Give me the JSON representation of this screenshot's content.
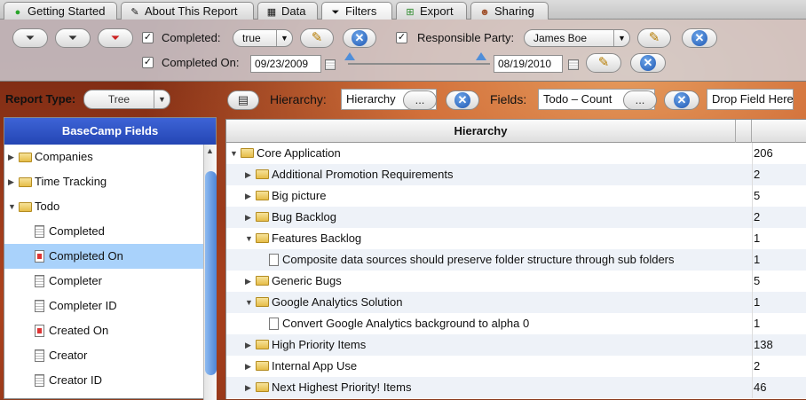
{
  "tabs": [
    {
      "label": "Getting Started",
      "icon": "green-dot-icon"
    },
    {
      "label": "About This Report",
      "icon": "pencil-note-icon"
    },
    {
      "label": "Data",
      "icon": "table-icon"
    },
    {
      "label": "Filters",
      "icon": "funnel-icon",
      "active": true
    },
    {
      "label": "Export",
      "icon": "export-icon"
    },
    {
      "label": "Sharing",
      "icon": "people-icon"
    }
  ],
  "filters": {
    "completed": {
      "label": "Completed:",
      "value": "true",
      "checked": true
    },
    "responsible": {
      "label": "Responsible Party:",
      "value": "James Boe",
      "checked": true
    },
    "completed_on": {
      "label": "Completed On:",
      "from": "09/23/2009",
      "to": "08/19/2010",
      "checked": true
    }
  },
  "toolbar": {
    "report_type_label": "Report Type:",
    "report_type_value": "Tree",
    "hierarchy_label": "Hierarchy:",
    "hierarchy_value": "Hierarchy",
    "fields_label": "Fields:",
    "fields_value": "Todo – Count",
    "ellipsis": "...",
    "drop_field": "Drop Field Here"
  },
  "left_panel": {
    "title": "BaseCamp Fields",
    "items": [
      {
        "label": "Companies",
        "type": "folder"
      },
      {
        "label": "Time Tracking",
        "type": "folder"
      },
      {
        "label": "Todo",
        "type": "folder-open"
      },
      {
        "label": "Completed",
        "type": "field"
      },
      {
        "label": "Completed On",
        "type": "date",
        "selected": true
      },
      {
        "label": "Completer",
        "type": "field"
      },
      {
        "label": "Completer ID",
        "type": "field"
      },
      {
        "label": "Created On",
        "type": "date"
      },
      {
        "label": "Creator",
        "type": "field"
      },
      {
        "label": "Creator ID",
        "type": "field"
      }
    ]
  },
  "grid": {
    "header": "Hierarchy",
    "rows": [
      {
        "label": "Core Application",
        "count": "206",
        "level": 0,
        "kind": "open"
      },
      {
        "label": "Additional Promotion Requirements",
        "count": "2",
        "level": 1,
        "kind": "closed"
      },
      {
        "label": "Big picture",
        "count": "5",
        "level": 1,
        "kind": "closed"
      },
      {
        "label": "Bug Backlog",
        "count": "2",
        "level": 1,
        "kind": "closed"
      },
      {
        "label": "Features Backlog",
        "count": "1",
        "level": 1,
        "kind": "open"
      },
      {
        "label": "Composite data sources should preserve folder structure through sub folders",
        "count": "1",
        "level": 2,
        "kind": "doc"
      },
      {
        "label": "Generic Bugs",
        "count": "5",
        "level": 1,
        "kind": "closed"
      },
      {
        "label": "Google Analytics Solution",
        "count": "1",
        "level": 1,
        "kind": "open"
      },
      {
        "label": "Convert Google Analytics background to alpha 0",
        "count": "1",
        "level": 2,
        "kind": "doc"
      },
      {
        "label": "High Priority Items",
        "count": "138",
        "level": 1,
        "kind": "closed"
      },
      {
        "label": "Internal App Use",
        "count": "2",
        "level": 1,
        "kind": "closed"
      },
      {
        "label": "Next Highest Priority! Items",
        "count": "46",
        "level": 1,
        "kind": "closed"
      }
    ]
  }
}
